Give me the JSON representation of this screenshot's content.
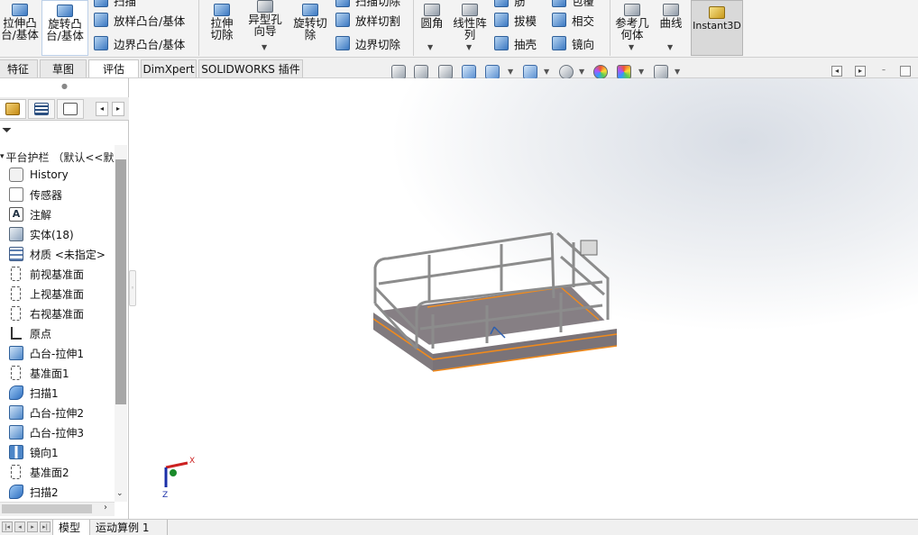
{
  "ribbon": {
    "boss_extrude": "拉伸凸台/基体",
    "revolve_boss": "旋转凸台/基体",
    "swept_boss": "扫描",
    "lofted_boss": "放样凸台/基体",
    "boundary_boss": "边界凸台/基体",
    "extruded_cut": "拉伸切除",
    "hole_wizard": "异型孔向导",
    "revolved_cut": "旋转切除",
    "swept_cut": "扫描切除",
    "lofted_cut": "放样切割",
    "boundary_cut": "边界切除",
    "fillet": "圆角",
    "linear_pattern": "线性阵列",
    "rib": "筋",
    "draft": "拔模",
    "shell": "抽壳",
    "wrap": "包覆",
    "intersect": "相交",
    "mirror": "镜向",
    "reference_geometry": "参考几何体",
    "curves": "曲线",
    "instant3d": "Instant3D"
  },
  "tabs": [
    {
      "label": "特征"
    },
    {
      "label": "草图"
    },
    {
      "label": "评估"
    },
    {
      "label": "DimXpert"
    },
    {
      "label": "SOLIDWORKS 插件"
    }
  ],
  "tree": {
    "root": "平台护栏 （默认<<默",
    "items": [
      {
        "label": "History",
        "icon": "history-icon"
      },
      {
        "label": "传感器",
        "icon": "sensor-icon"
      },
      {
        "label": "注解",
        "icon": "annotation-icon",
        "glyph": "A"
      },
      {
        "label": "实体(18)",
        "icon": "solid-bodies-icon"
      },
      {
        "label": "材质 <未指定>",
        "icon": "material-icon"
      },
      {
        "label": "前视基准面",
        "icon": "plane-icon"
      },
      {
        "label": "上视基准面",
        "icon": "plane-icon"
      },
      {
        "label": "右视基准面",
        "icon": "plane-icon"
      },
      {
        "label": "原点",
        "icon": "origin-icon"
      },
      {
        "label": "凸台-拉伸1",
        "icon": "extrude-icon"
      },
      {
        "label": "基准面1",
        "icon": "plane-icon"
      },
      {
        "label": "扫描1",
        "icon": "sweep-icon"
      },
      {
        "label": "凸台-拉伸2",
        "icon": "extrude-icon"
      },
      {
        "label": "凸台-拉伸3",
        "icon": "extrude-icon"
      },
      {
        "label": "镜向1",
        "icon": "mirror-icon"
      },
      {
        "label": "基准面2",
        "icon": "plane-icon"
      },
      {
        "label": "扫描2",
        "icon": "sweep-icon"
      }
    ]
  },
  "triad": {
    "x": "X",
    "z": "Z"
  },
  "bottom_tabs": [
    {
      "label": "模型"
    },
    {
      "label": "运动算例 1"
    }
  ],
  "colors": {
    "selection_edge": "#f08a1c",
    "platform_fill": "#7c7479",
    "rail": "#8c8c8c"
  }
}
